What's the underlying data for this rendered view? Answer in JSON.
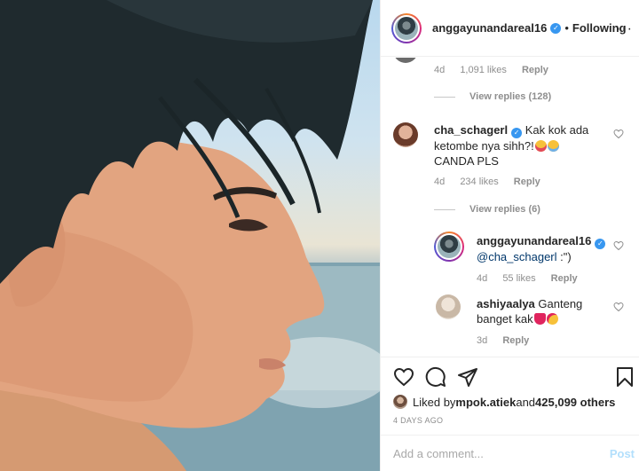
{
  "header": {
    "username": "anggayunandareal16",
    "verified_mark": "✓",
    "separator": "•",
    "follow_label": "Following",
    "more_label": "···"
  },
  "comments": {
    "top_partial": {
      "age": "4d",
      "likes": "1,091 likes",
      "reply_label": "Reply",
      "view_replies": "View replies (128)"
    },
    "c1": {
      "username": "cha_schagerl",
      "text_line1": "Kak kok ada",
      "text_line2": "ketombe nya sihh?!",
      "text_line3": "CANDA PLS",
      "emoji": [
        "squinting-tongue-emoji",
        "rolling-laughing-emoji"
      ],
      "age": "4d",
      "likes": "234 likes",
      "reply_label": "Reply",
      "view_replies": "View replies (6)"
    },
    "r1": {
      "username": "anggayunandareal16",
      "mention": "@cha_schagerl",
      "text": " :\")",
      "age": "4d",
      "likes": "55 likes",
      "reply_label": "Reply"
    },
    "r2": {
      "username": "ashiyaalya",
      "text_line1": "Ganteng",
      "text_line2": "banget kak",
      "emoji": [
        "red-heart-emoji",
        "heart-eyes-emoji"
      ],
      "age": "3d",
      "reply_label": "Reply"
    }
  },
  "actions": {
    "icons": [
      "heart-icon",
      "comment-icon",
      "share-icon",
      "bookmark-icon"
    ],
    "liked_by_prefix": "Liked by ",
    "liked_by_user": "mpok.atiek",
    "liked_by_mid": " and ",
    "liked_by_count": "425,099 others",
    "date": "4 DAYS AGO"
  },
  "add_comment": {
    "placeholder": "Add a comment...",
    "post_label": "Post"
  },
  "colors": {
    "link_blue": "#3897f0",
    "post_disabled": "#b2dffc",
    "secondary_text": "#8e8e8e",
    "primary_text": "#262626"
  }
}
